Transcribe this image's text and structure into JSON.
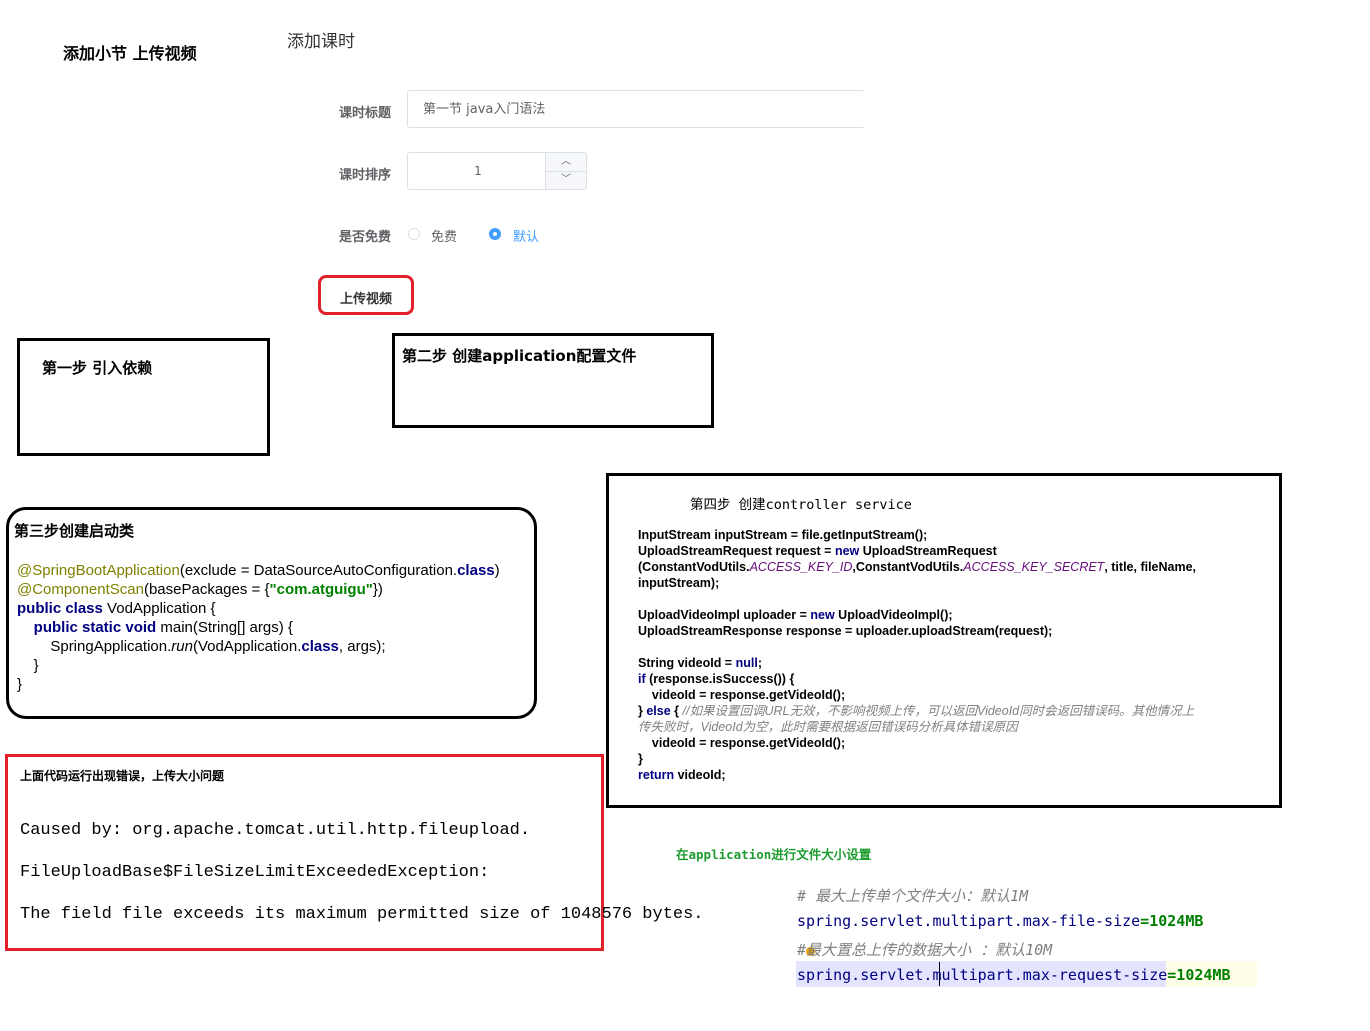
{
  "header": {
    "title": "添加小节 上传视频",
    "subtitle": "添加课时"
  },
  "form": {
    "lesson_title_label": "课时标题",
    "lesson_title_value": "第一节 java入门语法",
    "lesson_sort_label": "课时排序",
    "lesson_sort_value": "1",
    "stepper_up": "︿",
    "stepper_down": "﹀",
    "free_label": "是否免费",
    "free_options": [
      {
        "label": "免费",
        "selected": false
      },
      {
        "label": "默认",
        "selected": true
      }
    ],
    "upload_label": "上传视频"
  },
  "steps": {
    "step1": "第一步 引入依赖",
    "step2": "第二步 创建application配置文件",
    "step3": {
      "title": "第三步创建启动类",
      "code": {
        "l1a": "@SpringBootApplication",
        "l1b": "(exclude = DataSourceAutoConfiguration.",
        "l1c": "class",
        "l1d": ")",
        "l2a": "@ComponentScan",
        "l2b": "(basePackages = {",
        "l2c": "\"com.atguigu\"",
        "l2d": "})",
        "l3a": "public class ",
        "l3b": "VodApplication {",
        "l4a": "public static void ",
        "l4b": "main(String[] args) {",
        "l5a": "SpringApplication.",
        "l5b": "run",
        "l5c": "(VodApplication.",
        "l5d": "class",
        "l5e": ", args);",
        "l6": "}",
        "l7": "}"
      }
    },
    "step4": {
      "title": "第四步 创建controller service",
      "code": {
        "a1": "InputStream inputStream = file.getInputStream();",
        "a2a": "UploadStreamRequest request = ",
        "a2b": "new ",
        "a2c": "UploadStreamRequest",
        "a3a": "(ConstantVodUtils.",
        "a3b": "ACCESS_KEY_ID",
        "a3c": ",ConstantVodUtils.",
        "a3d": "ACCESS_KEY_SECRET",
        "a3e": ", title, fileName,",
        "a4": "inputStream);",
        "b1a": "UploadVideoImpl uploader = ",
        "b1b": "new ",
        "b1c": "UploadVideoImpl();",
        "b2": "UploadStreamResponse response = uploader.uploadStream(request);",
        "c1a": "String videoId = ",
        "c1b": "null",
        "c1c": ";",
        "c2a": "if ",
        "c2b": "(response.isSuccess()) {",
        "c3": "videoId = response.getVideoId();",
        "c4a": "} ",
        "c4b": "else ",
        "c4c": "{ ",
        "c4d": "//如果设置回调URL无效，不影响视频上传，可以返回VideoId同时会返回错误码。其他情况上",
        "c5": "传失败时，VideoId为空，此时需要根据返回错误码分析具体错误原因",
        "c6": "videoId = response.getVideoId();",
        "c7": "}",
        "c8a": "return ",
        "c8b": "videoId;"
      }
    }
  },
  "error": {
    "title": "上面代码运行出现错误，上传大小问题",
    "line1": "Caused by: org.apache.tomcat.util.http.fileupload.",
    "line2": "FileUploadBase$FileSizeLimitExceededException:",
    "line3": "The field file exceeds its maximum permitted size of 1048576 bytes."
  },
  "config": {
    "note": "在application进行文件大小设置",
    "comment1": "# 最大上传单个文件大小：默认1M",
    "key1": "spring.servlet.multipart.max-file-size",
    "val1": "=1024MB",
    "comment2": "#最大置总上传的数据大小 ：默认10M",
    "key2": "spring.servlet.multipart.max-request-size",
    "val2": "=1024MB"
  },
  "colors": {
    "accent": "#409eff",
    "highlight": "#e0202a"
  }
}
